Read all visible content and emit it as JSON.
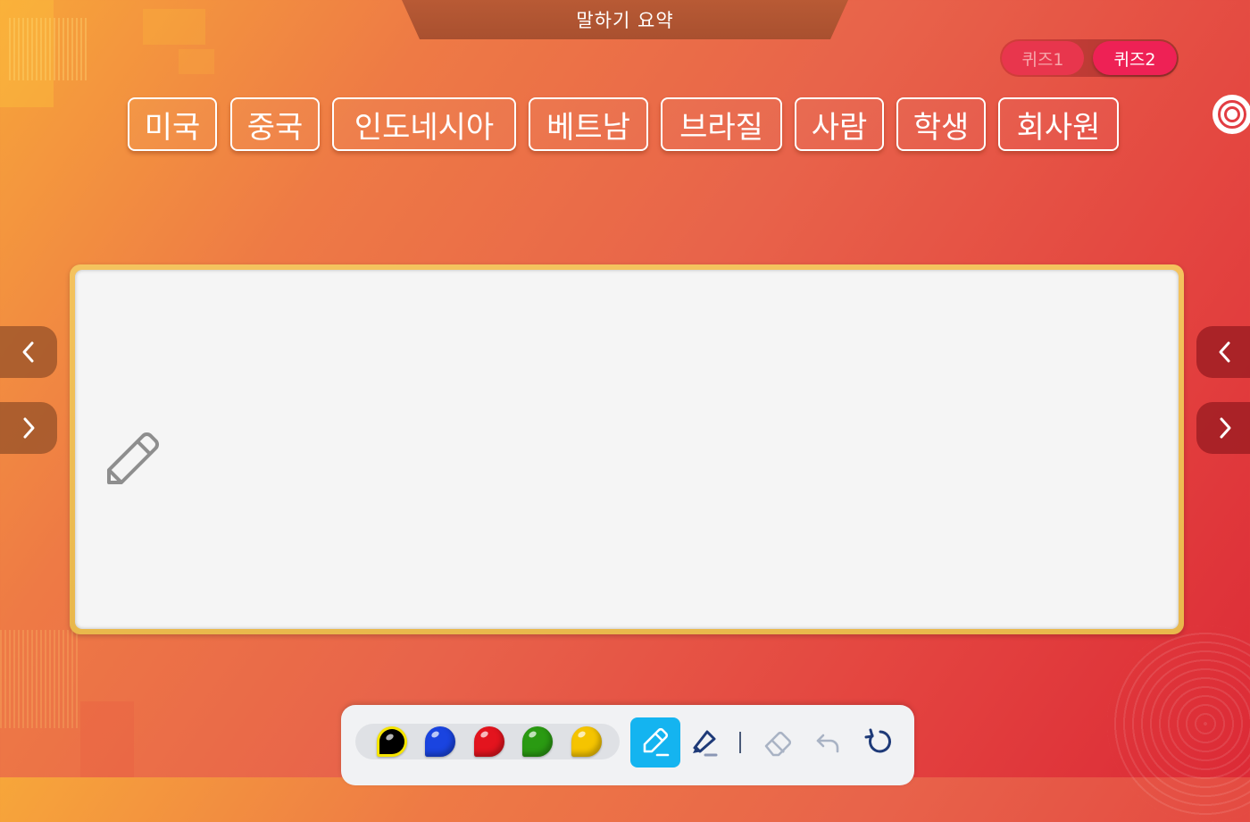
{
  "header": {
    "title": "말하기 요약"
  },
  "quiz_tabs": [
    {
      "label": "퀴즈1",
      "active": false
    },
    {
      "label": "퀴즈2",
      "active": true
    }
  ],
  "words": [
    "미국",
    "중국",
    "인도네시아",
    "베트남",
    "브라질",
    "사람",
    "학생",
    "회사원"
  ],
  "board": {
    "icon": "pencil-icon"
  },
  "navigation": {
    "left": [
      "chevron-left-icon",
      "chevron-right-icon"
    ],
    "right": [
      "chevron-left-icon",
      "chevron-right-icon"
    ]
  },
  "toolbar": {
    "colors": [
      "#000000",
      "#1a44e0",
      "#e3141e",
      "#2a9a12",
      "#f5c400"
    ],
    "selected_color": "#000000",
    "tools": [
      "pen-icon",
      "highlighter-icon",
      "eraser-icon",
      "undo-icon",
      "reset-icon"
    ],
    "active_tool": "pen-icon"
  },
  "theme": {
    "accent": "#ee2155",
    "tool_active": "#14b4f0",
    "board_border": "#f4c35e"
  }
}
